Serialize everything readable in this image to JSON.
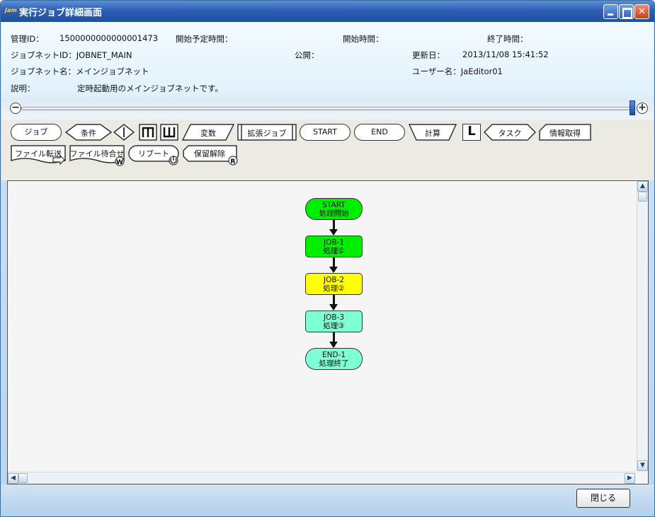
{
  "window": {
    "logo": "Jam",
    "title": "実行ジョブ詳細画面"
  },
  "info": {
    "mgmt_id_label": "管理ID：",
    "mgmt_id_value": "1500000000000001473",
    "sched_start_label": "開始予定時間：",
    "start_label": "開始時間：",
    "end_label": "終了時間：",
    "jobnet_id_label": "ジョブネットID：JOBNET_MAIN",
    "public_label": "公開：",
    "updated_label": "更新日：",
    "updated_value": "2013/11/08 15:41:52",
    "jobnet_name_label": "ジョブネット名：メインジョブネット",
    "user_label": "ユーザー名：JaEditor01",
    "desc_label": "説明：",
    "desc_value": "定時起動用のメインジョブネットです。"
  },
  "palette": {
    "job": "ジョブ",
    "condition": "条件",
    "variable": "変数",
    "ext_job": "拡張ジョブ",
    "start": "START",
    "end": "END",
    "calc": "計算",
    "task": "タスク",
    "info_get": "情報取得",
    "file_transfer": "ファイル転送",
    "file_wait": "ファイル待合せ",
    "reboot": "リブート",
    "hold_release": "保留解除",
    "l_icon": "L"
  },
  "flow": {
    "nodes": [
      {
        "id": "START",
        "label": "処理開始",
        "color": "#00ee00"
      },
      {
        "id": "JOB-1",
        "label": "処理①",
        "color": "#00ee00"
      },
      {
        "id": "JOB-2",
        "label": "処理②",
        "color": "#ffff00"
      },
      {
        "id": "JOB-3",
        "label": "処理③",
        "color": "#7fffd4"
      },
      {
        "id": "END-1",
        "label": "処理終了",
        "color": "#7fffd4"
      }
    ]
  },
  "footer": {
    "close_label": "閉じる"
  }
}
